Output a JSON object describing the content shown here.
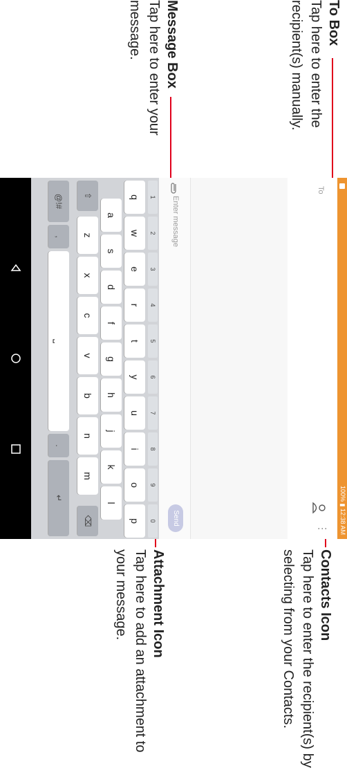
{
  "annotations": {
    "to_box": {
      "title": "To Box",
      "lines": [
        "Tap here to enter the",
        "recipient(s) manually."
      ]
    },
    "message_box": {
      "title": "Message Box",
      "lines": [
        "Tap here to enter your",
        "message."
      ]
    },
    "contacts_icon": {
      "title": "Contacts Icon",
      "lines": [
        "Tap here to enter the recipient(s) by",
        "selecting from your Contacts."
      ]
    },
    "attachment_icon": {
      "title": "Attachment Icon",
      "lines": [
        "Tap here to add an attachment to",
        "your message."
      ]
    }
  },
  "status": {
    "battery": "100%",
    "time": "12:38 AM"
  },
  "compose": {
    "to_label": "To",
    "placeholder": "Enter message",
    "send_label": "Send"
  },
  "keyboard": {
    "numbers": [
      "1",
      "2",
      "3",
      "4",
      "5",
      "6",
      "7",
      "8",
      "9",
      "0"
    ],
    "row1": [
      "q",
      "w",
      "e",
      "r",
      "t",
      "y",
      "u",
      "i",
      "o",
      "p"
    ],
    "row2": [
      "a",
      "s",
      "d",
      "f",
      "g",
      "h",
      "j",
      "k",
      "l"
    ],
    "row3": [
      "z",
      "x",
      "c",
      "v",
      "b",
      "n",
      "m"
    ],
    "symbols_label": "@!#",
    "comma": ",",
    "period": "."
  },
  "colors": {
    "accent": "#ee9430",
    "callout_line": "#e0001b",
    "send_button": "#c7cae4"
  }
}
